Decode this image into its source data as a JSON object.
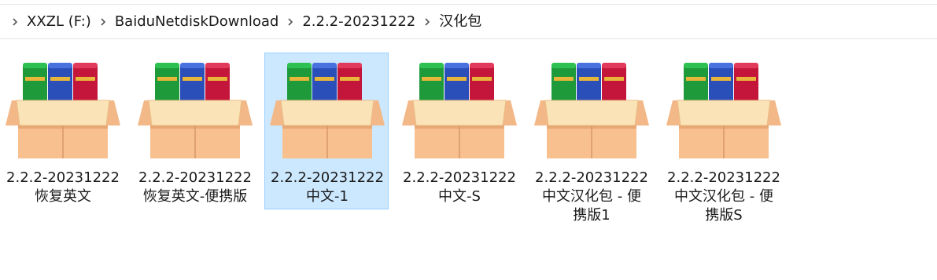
{
  "breadcrumb": {
    "items": [
      "XXZL (F:)",
      "BaiduNetdiskDownload",
      "2.2.2-20231222",
      "汉化包"
    ]
  },
  "files": [
    {
      "line1": "2.2.2-20231222",
      "line2": "恢复英文",
      "line3": "",
      "selected": false
    },
    {
      "line1": "2.2.2-20231222",
      "line2": "恢复英文-便携版",
      "line3": "",
      "selected": false
    },
    {
      "line1": "2.2.2-20231222",
      "line2": "中文-1",
      "line3": "",
      "selected": true
    },
    {
      "line1": "2.2.2-20231222",
      "line2": "中文-S",
      "line3": "",
      "selected": false
    },
    {
      "line1": "2.2.2-20231222",
      "line2": "中文汉化包 - 便",
      "line3": "携版1",
      "selected": false
    },
    {
      "line1": "2.2.2-20231222",
      "line2": "中文汉化包 - 便",
      "line3": "携版S",
      "selected": false
    }
  ],
  "icon": "archive-box-with-books-icon",
  "colors": {
    "selection_bg": "#cce8ff",
    "selection_border": "#99d1ff",
    "book_green": "#1e9a3a",
    "book_blue": "#2a4fb8",
    "book_red": "#c4163a",
    "box_tan": "#f7c08e"
  }
}
